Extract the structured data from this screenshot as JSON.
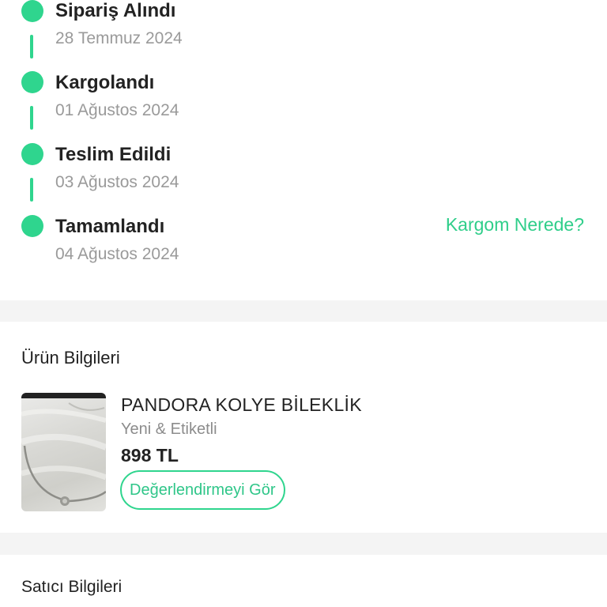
{
  "timeline": {
    "steps": [
      {
        "title": "Sipariş Alındı",
        "date": "28 Temmuz 2024"
      },
      {
        "title": "Kargolandı",
        "date": "01 Ağustos 2024"
      },
      {
        "title": "Teslim Edildi",
        "date": "03 Ağustos 2024"
      },
      {
        "title": "Tamamlandı",
        "date": "04 Ağustos 2024"
      }
    ],
    "track_link": "Kargom Nerede?",
    "accent_color": "#2fd58e"
  },
  "product_section": {
    "title": "Ürün Bilgileri",
    "product": {
      "name": "PANDORA KOLYE BİLEKLİK",
      "condition": "Yeni & Etiketli",
      "price": "898 TL",
      "review_button": "Değerlendirmeyi Gör"
    }
  },
  "seller_section": {
    "title": "Satıcı Bilgileri"
  }
}
